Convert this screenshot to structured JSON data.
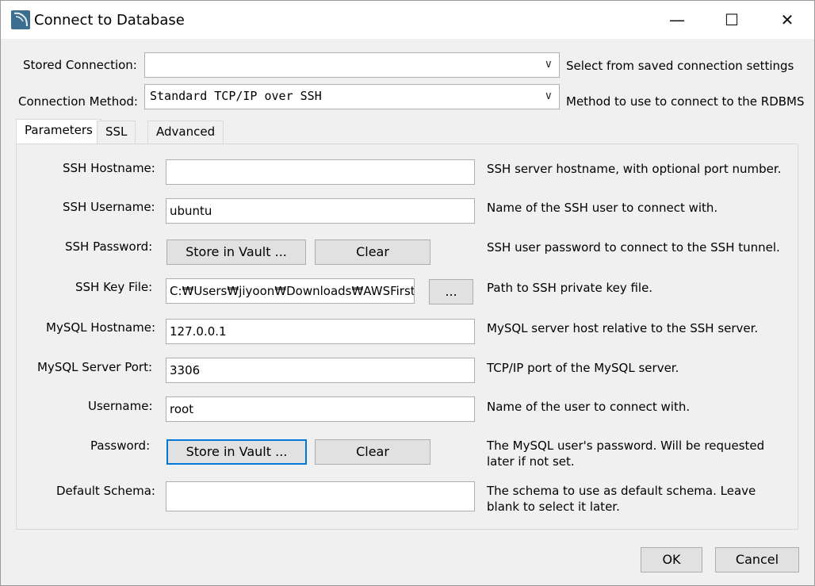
{
  "window": {
    "title": "Connect to Database",
    "controls": {
      "minimize": "—",
      "maximize": "☐",
      "close": "✕"
    }
  },
  "top": {
    "stored_connection": {
      "label": "Stored Connection:",
      "value": "",
      "hint": "Select from saved connection settings"
    },
    "connection_method": {
      "label": "Connection Method:",
      "value": "Standard TCP/IP over SSH",
      "hint": "Method to use to connect to the RDBMS"
    }
  },
  "tabs": [
    {
      "label": "Parameters",
      "active": true
    },
    {
      "label": "SSL",
      "active": false
    },
    {
      "label": "Advanced",
      "active": false
    }
  ],
  "params": {
    "ssh_hostname": {
      "label": "SSH Hostname:",
      "value": "",
      "hint": "SSH server hostname, with  optional port number."
    },
    "ssh_username": {
      "label": "SSH Username:",
      "value": "ubuntu",
      "hint": "Name of the SSH user to connect with."
    },
    "ssh_password": {
      "label": "SSH Password:",
      "store": "Store in Vault ...",
      "clear": "Clear",
      "hint": "SSH user password to connect to the SSH tunnel."
    },
    "ssh_key_file": {
      "label": "SSH Key File:",
      "value": "C:₩Users₩jiyoon₩Downloads₩AWSFirst",
      "browse": "...",
      "hint": "Path to SSH private key file."
    },
    "mysql_hostname": {
      "label": "MySQL Hostname:",
      "value": "127.0.0.1",
      "hint": "MySQL server host relative to the SSH server."
    },
    "mysql_port": {
      "label": "MySQL Server Port:",
      "value": "3306",
      "hint": "TCP/IP port of the MySQL server."
    },
    "username": {
      "label": "Username:",
      "value": "root",
      "hint": "Name of the user to connect with."
    },
    "password": {
      "label": "Password:",
      "store": "Store in Vault ...",
      "clear": "Clear",
      "hint1": "The MySQL user's password. Will be requested",
      "hint2": "later if not set."
    },
    "default_schema": {
      "label": "Default Schema:",
      "value": "",
      "hint1": "The schema to use as default schema. Leave",
      "hint2": "blank to select it later."
    }
  },
  "footer": {
    "ok": "OK",
    "cancel": "Cancel"
  },
  "colors": {
    "focus_border": "#0078d7",
    "button_bg": "#e1e1e1",
    "dialog_bg": "#f0f0f0"
  }
}
